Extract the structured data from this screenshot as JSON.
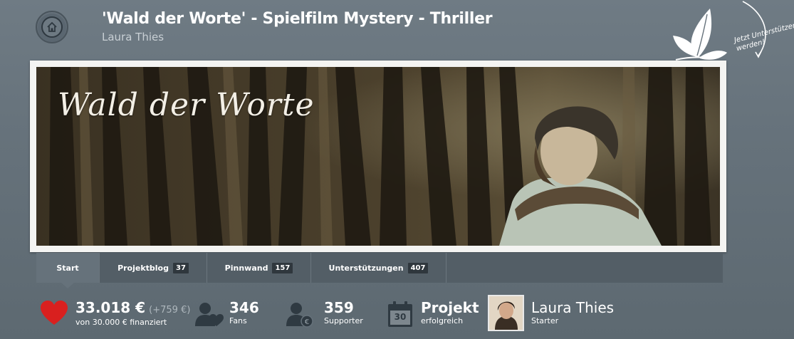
{
  "header": {
    "title": "'Wald der Worte' - Spielfilm Mystery - Thriller",
    "author": "Laura Thies",
    "badge_text": "Jetzt Unterstützer werden!"
  },
  "hero": {
    "title": "Wald der Worte"
  },
  "tabs": [
    {
      "label": "Start",
      "count": ""
    },
    {
      "label": "Projektblog",
      "count": "37"
    },
    {
      "label": "Pinnwand",
      "count": "157"
    },
    {
      "label": "Unterstützungen",
      "count": "407"
    }
  ],
  "stats": {
    "funding": {
      "amount": "33.018 €",
      "delta": "(+759 €)",
      "caption": "von 30.000 € finanziert"
    },
    "fans": {
      "value": "346",
      "label": "Fans"
    },
    "supporters": {
      "value": "359",
      "label": "Supporter"
    },
    "project": {
      "value": "Projekt",
      "label": "erfolgreich",
      "calendar_day": "30"
    },
    "starter": {
      "name": "Laura Thies",
      "label": "Starter"
    }
  },
  "colors": {
    "background": "#66727b",
    "tab_bar": "#535e66",
    "heart": "#d9201f",
    "icon_dark": "#2f3a42"
  }
}
